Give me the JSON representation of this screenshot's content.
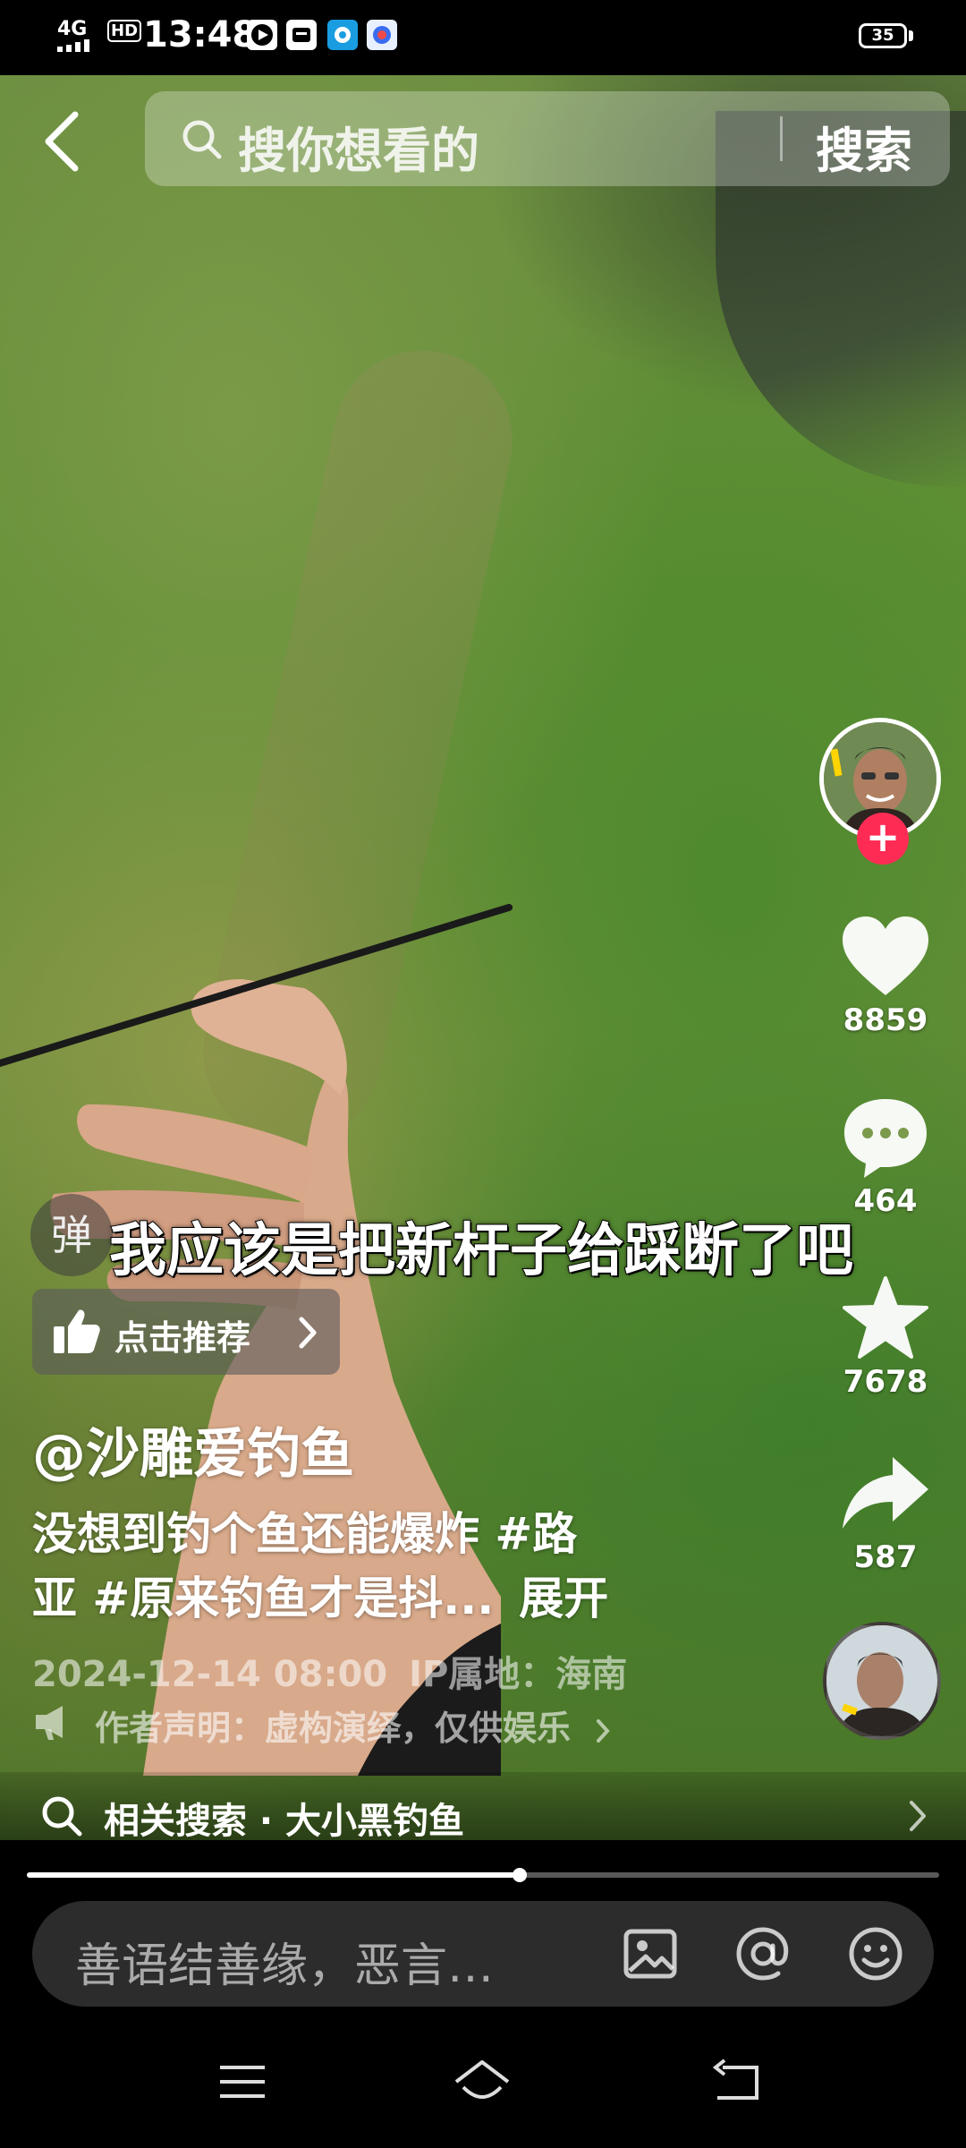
{
  "status_bar": {
    "network": "4G",
    "hd": "HD",
    "time": "13:48",
    "battery": "35"
  },
  "search": {
    "placeholder": "搜你想看的",
    "button_label": "搜索"
  },
  "actions": {
    "likes": "8859",
    "comments": "464",
    "favorites": "7678",
    "shares": "587"
  },
  "video": {
    "danmaku_label": "弹",
    "subtitle": "我应该是把新杆子给踩断了吧",
    "recommend_label": "点击推荐"
  },
  "caption": {
    "author": "@沙雕爱钓鱼",
    "description_line1": "没想到钓个鱼还能爆炸 #路",
    "description_line2": "亚 #原来钓鱼才是抖...",
    "expand": "展开",
    "date": "2024-12-14 08:00",
    "ip_location": "IP属地：海南",
    "author_statement": "作者声明：虚构演绎，仅供娱乐"
  },
  "related_search": {
    "label": "相关搜索 · 大小黑钓鱼"
  },
  "progress": {
    "played_fraction": 0.54
  },
  "comment_bar": {
    "placeholder": "善语结善缘，恶言…"
  },
  "colors": {
    "follow_red": "#fe2c55",
    "comment_bar_bg": "#2c2c2c"
  },
  "icons": {
    "back": "chevron-left-icon",
    "search": "search-icon",
    "like": "heart-icon",
    "comment": "speech-bubble-icon",
    "favorite": "star-icon",
    "share": "share-arrow-icon",
    "recommend": "thumbs-up-icon",
    "statement": "megaphone-icon",
    "image": "image-icon",
    "mention": "at-icon",
    "emoji": "emoji-icon",
    "nav_menu": "menu-icon",
    "nav_home": "home-icon",
    "nav_back": "back-icon"
  }
}
